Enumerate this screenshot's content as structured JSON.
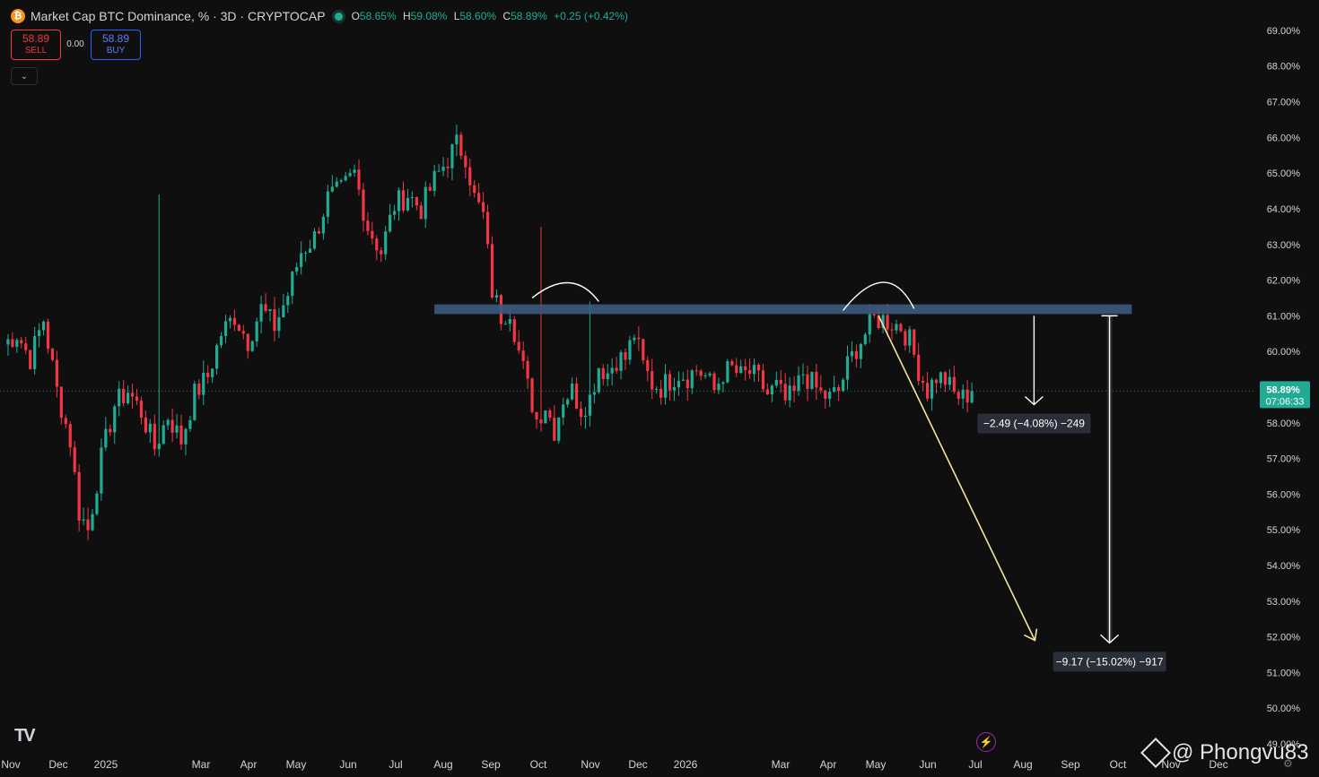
{
  "header": {
    "title": "Market Cap BTC Dominance, % · 3D · CRYPTOCAP",
    "ohlc": [
      {
        "k": "O",
        "v": "58.65%"
      },
      {
        "k": "H",
        "v": "59.08%"
      },
      {
        "k": "L",
        "v": "58.60%"
      },
      {
        "k": "C",
        "v": "58.89%"
      }
    ],
    "change": "+0.25 (+0.42%)"
  },
  "trade": {
    "sell_price": "58.89",
    "sell_label": "SELL",
    "spread": "0.00",
    "buy_price": "58.89",
    "buy_label": "BUY"
  },
  "price_tag": {
    "value": "58.89%",
    "countdown": "07:06:33"
  },
  "watermark": "@ Phongvu83",
  "colors": {
    "up": "#22ab94",
    "down": "#f23645",
    "zone": "#3d5a80",
    "arrow": "#ffffff",
    "projection": "#f2e6a0"
  },
  "chart_data": {
    "type": "candlestick",
    "ylim": [
      48.9,
      69.3
    ],
    "y_ticks": [
      "69.00%",
      "68.00%",
      "67.00%",
      "66.00%",
      "65.00%",
      "64.00%",
      "63.00%",
      "62.00%",
      "61.00%",
      "60.00%",
      "59.00%",
      "58.00%",
      "57.00%",
      "56.00%",
      "55.00%",
      "54.00%",
      "53.00%",
      "52.00%",
      "51.00%",
      "50.00%",
      "49.00%"
    ],
    "x_ticks": [
      "Nov",
      "Dec",
      "2025",
      "Mar",
      "Apr",
      "May",
      "Jun",
      "Jul",
      "Aug",
      "Sep",
      "Oct",
      "Nov",
      "Dec",
      "2026",
      "Mar",
      "Apr",
      "May",
      "Jun",
      "Jul",
      "Aug",
      "Sep",
      "Oct",
      "Nov",
      "Dec"
    ],
    "series_path": [
      [
        0,
        60.2
      ],
      [
        3,
        60.5
      ],
      [
        6,
        59.8
      ],
      [
        9,
        60.9
      ],
      [
        12,
        58.9
      ],
      [
        15,
        57.5
      ],
      [
        17,
        55.5
      ],
      [
        19,
        55.0
      ],
      [
        22,
        57.0
      ],
      [
        25,
        58.5
      ],
      [
        28,
        58.9
      ],
      [
        31,
        58.3
      ],
      [
        34,
        57.3
      ],
      [
        37,
        58.2
      ],
      [
        40,
        57.5
      ],
      [
        43,
        58.8
      ],
      [
        46,
        59.3
      ],
      [
        49,
        60.5
      ],
      [
        52,
        61.0
      ],
      [
        55,
        60.3
      ],
      [
        58,
        61.2
      ],
      [
        61,
        60.7
      ],
      [
        64,
        61.6
      ],
      [
        67,
        62.8
      ],
      [
        70,
        63.2
      ],
      [
        73,
        64.3
      ],
      [
        76,
        64.5
      ],
      [
        79,
        65.0
      ],
      [
        82,
        63.5
      ],
      [
        85,
        62.8
      ],
      [
        88,
        64.1
      ],
      [
        91,
        64.4
      ],
      [
        94,
        64.0
      ],
      [
        97,
        64.8
      ],
      [
        100,
        65.4
      ],
      [
        102,
        65.8
      ],
      [
        104,
        65.5
      ],
      [
        106,
        64.3
      ],
      [
        108,
        63.8
      ],
      [
        110,
        61.7
      ],
      [
        112,
        61.0
      ],
      [
        114,
        61.2
      ],
      [
        116,
        60.0
      ],
      [
        118,
        59.0
      ],
      [
        120,
        58.1
      ],
      [
        122,
        58.5
      ],
      [
        124,
        57.8
      ],
      [
        126,
        58.7
      ],
      [
        128,
        58.9
      ],
      [
        130,
        58.4
      ],
      [
        132,
        58.7
      ],
      [
        134,
        59.6
      ],
      [
        136,
        59.4
      ],
      [
        138,
        59.8
      ],
      [
        140,
        59.8
      ],
      [
        142,
        60.5
      ],
      [
        144,
        59.6
      ],
      [
        146,
        59.1
      ],
      [
        148,
        59.0
      ],
      [
        150,
        59.2
      ],
      [
        152,
        59.4
      ],
      [
        154,
        59.3
      ],
      [
        156,
        59.5
      ],
      [
        158,
        59.3
      ],
      [
        160,
        58.9
      ],
      [
        162,
        59.4
      ],
      [
        164,
        59.5
      ],
      [
        166,
        59.3
      ],
      [
        168,
        59.4
      ],
      [
        170,
        59.2
      ],
      [
        172,
        58.8
      ],
      [
        174,
        59.0
      ],
      [
        176,
        58.6
      ],
      [
        178,
        58.8
      ],
      [
        180,
        59.4
      ],
      [
        182,
        59.1
      ],
      [
        184,
        58.8
      ],
      [
        186,
        58.7
      ],
      [
        188,
        58.9
      ],
      [
        190,
        59.6
      ],
      [
        192,
        60.1
      ],
      [
        194,
        60.5
      ],
      [
        196,
        60.9
      ],
      [
        198,
        60.9
      ],
      [
        200,
        60.8
      ],
      [
        202,
        60.7
      ],
      [
        204,
        60.3
      ],
      [
        206,
        59.5
      ],
      [
        208,
        58.9
      ],
      [
        210,
        59.3
      ],
      [
        212,
        59.2
      ],
      [
        214,
        58.8
      ],
      [
        216,
        58.7
      ],
      [
        218,
        58.89
      ]
    ],
    "spikes": [
      {
        "i": 35,
        "high": 64.4
      },
      {
        "i": 121,
        "high": 63.5
      },
      {
        "i": 132,
        "high": 61.4
      }
    ],
    "drawings": {
      "resistance_zone": {
        "x1_index": 97,
        "x2_index": 254,
        "top": 61.32,
        "bottom": 61.05
      },
      "projection_line": {
        "from_index": 197,
        "from": 61.0,
        "to_index": 232,
        "to": 51.9
      },
      "measure_small": {
        "index": 232,
        "from": 61.0,
        "to": 58.51,
        "label": "−2.49 (−4.08%) −249"
      },
      "measure_large": {
        "index": 249,
        "from": 61.0,
        "to": 51.83,
        "label": "−9.17 (−15.02%) −917"
      }
    }
  }
}
